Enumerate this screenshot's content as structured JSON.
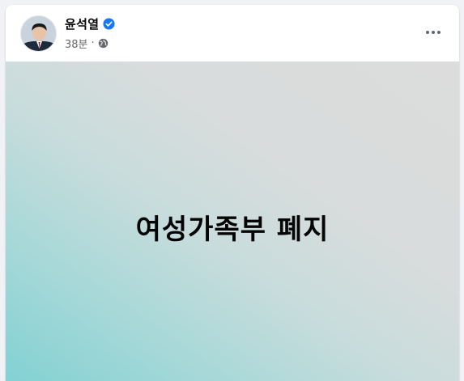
{
  "post": {
    "author_name": "윤석열",
    "timestamp": "38분",
    "separator": "·",
    "audience_icon": "globe-icon",
    "verified_icon": "verified-badge-icon",
    "more_icon": "more-options-icon",
    "content_text": "여성가족부 폐지"
  },
  "colors": {
    "verified_blue": "#1877f2",
    "gradient_teal": "#82d1d3",
    "gradient_gray": "#dcdcdc",
    "text_primary": "#050505",
    "text_secondary": "#65676b"
  }
}
